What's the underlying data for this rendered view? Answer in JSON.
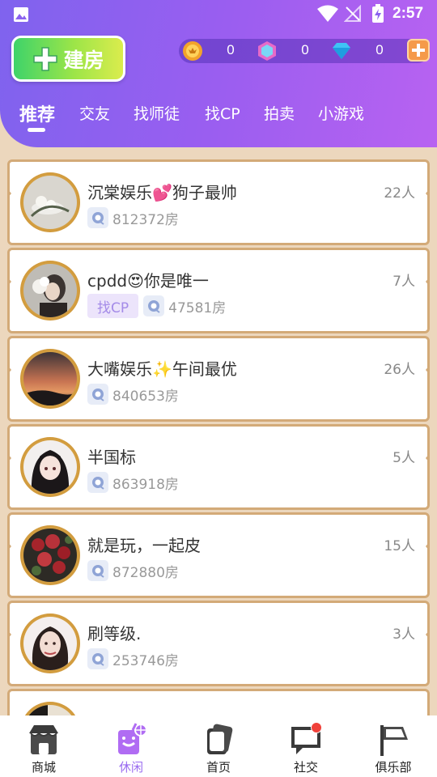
{
  "status_bar": {
    "time": "2:57",
    "icons": [
      "gallery-icon",
      "wifi-icon",
      "no-signal-icon",
      "battery-charging-icon"
    ]
  },
  "header": {
    "build_button": "建房",
    "currencies": [
      {
        "name": "coin-icon",
        "value": "0"
      },
      {
        "name": "gem-icon",
        "value": "0"
      },
      {
        "name": "diamond-icon",
        "value": "0"
      }
    ],
    "add_icon": "plus-icon"
  },
  "tabs": [
    {
      "label": "推荐",
      "active": true
    },
    {
      "label": "交友"
    },
    {
      "label": "找师徒"
    },
    {
      "label": "找CP"
    },
    {
      "label": "拍卖"
    },
    {
      "label": "小游戏"
    }
  ],
  "rooms": [
    {
      "title": "沉棠娱乐💕狗子最帅",
      "count": "22人",
      "tag": "",
      "room_id": "812372房"
    },
    {
      "title": "cpdd😍你是唯一",
      "count": "7人",
      "tag": "找CP",
      "room_id": "47581房"
    },
    {
      "title": "大嘴娱乐✨午间最优",
      "count": "26人",
      "tag": "",
      "room_id": "840653房"
    },
    {
      "title": "半国标",
      "count": "5人",
      "tag": "",
      "room_id": "863918房"
    },
    {
      "title": "就是玩，一起皮",
      "count": "15人",
      "tag": "",
      "room_id": "872880房"
    },
    {
      "title": "刷等级.",
      "count": "3人",
      "tag": "",
      "room_id": "253746房"
    },
    {
      "title": "",
      "count": "",
      "tag": "",
      "room_id": ""
    }
  ],
  "bottom_nav": [
    {
      "label": "商城",
      "icon": "shop-icon"
    },
    {
      "label": "休闲",
      "icon": "leisure-icon",
      "active": true
    },
    {
      "label": "首页",
      "icon": "home-icon"
    },
    {
      "label": "社交",
      "icon": "chat-icon",
      "badge": true
    },
    {
      "label": "俱乐部",
      "icon": "flag-icon"
    }
  ],
  "colors": {
    "header_gradient_start": "#7f63ee",
    "header_gradient_end": "#b862f1",
    "background": "#ecd7bd",
    "card_border": "#d3aa78",
    "active_nav": "#9a6cf0",
    "build_button_start": "#3ed36a",
    "build_button_end": "#dbec4d"
  }
}
